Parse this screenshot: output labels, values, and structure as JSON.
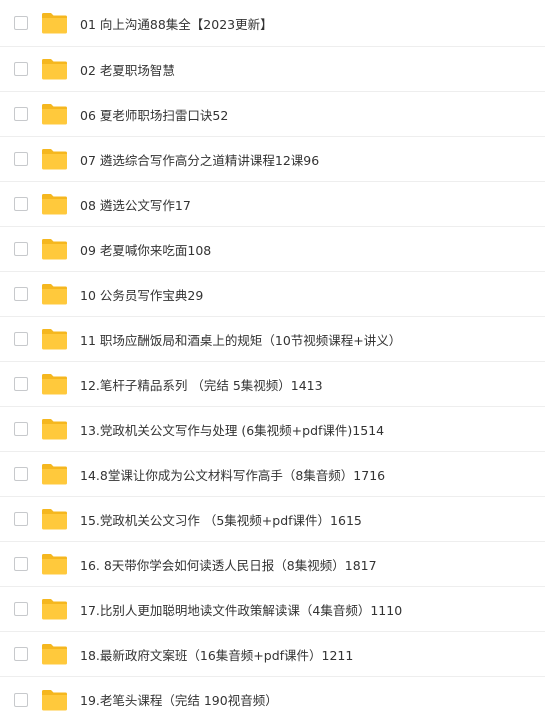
{
  "colors": {
    "folder_body": "#FFC93C",
    "folder_tab": "#F5B71F",
    "text": "#333333",
    "divider": "#eeeeee"
  },
  "files": [
    {
      "name": "01 向上沟通88集全【2023更新】",
      "icon": "folder-icon"
    },
    {
      "name": "02 老夏职场智慧",
      "icon": "folder-icon"
    },
    {
      "name": "06 夏老师职场扫雷口诀52",
      "icon": "folder-icon"
    },
    {
      "name": "07 遴选综合写作高分之道精讲课程12课96",
      "icon": "folder-icon"
    },
    {
      "name": "08 遴选公文写作17",
      "icon": "folder-icon"
    },
    {
      "name": "09 老夏喊你来吃面108",
      "icon": "folder-icon"
    },
    {
      "name": "10 公务员写作宝典29",
      "icon": "folder-icon"
    },
    {
      "name": "11 职场应酬饭局和酒桌上的规矩（10节视频课程+讲义）",
      "icon": "folder-icon"
    },
    {
      "name": "12.笔杆子精品系列 （完结 5集视频）1413",
      "icon": "folder-icon"
    },
    {
      "name": "13.党政机关公文写作与处理 (6集视频+pdf课件)1514",
      "icon": "folder-icon"
    },
    {
      "name": "14.8堂课让你成为公文材料写作高手（8集音频）1716",
      "icon": "folder-icon"
    },
    {
      "name": "15.党政机关公文习作 （5集视频+pdf课件）1615",
      "icon": "folder-icon"
    },
    {
      "name": "16. 8天带你学会如何读透人民日报（8集视频）1817",
      "icon": "folder-icon"
    },
    {
      "name": "17.比别人更加聪明地读文件政策解读课（4集音频）1110",
      "icon": "folder-icon"
    },
    {
      "name": "18.最新政府文案班（16集音频+pdf课件）1211",
      "icon": "folder-icon"
    },
    {
      "name": "19.老笔头课程（完结 190视音频）",
      "icon": "folder-icon"
    }
  ]
}
